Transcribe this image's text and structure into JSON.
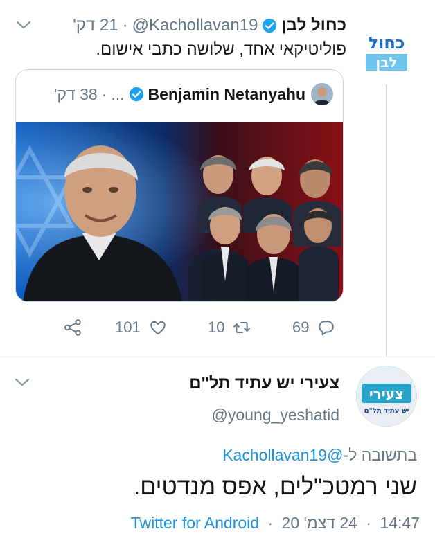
{
  "tweet1": {
    "author_name": "כחול לבן",
    "handle": "@Kachollavan19",
    "separator": "·",
    "time": "21 דק'",
    "text": "פוליטיקאי אחד, שלושה כתבי אישום.",
    "avatar_text_top": "כחול",
    "avatar_text_bottom": "לבן",
    "quoted": {
      "author_name": "Benjamin Netanyahu",
      "handle": "...",
      "separator": "·",
      "time": "38 דק'"
    },
    "actions": {
      "replies": "69",
      "retweets": "10",
      "likes": "101"
    }
  },
  "tweet2": {
    "author_name": "צעירי יש עתיד תל\"ם",
    "handle": "@young_yeshatid",
    "avatar_text_top": "צעירי",
    "avatar_text_bottom": "יש עתיד תל\"ם",
    "replying_prefix": "בתשובה ל-",
    "replying_to": "@Kachollavan19",
    "text": "שני רמטכ\"לים, אפס מנדטים.",
    "time": "14:47",
    "date": "24 דצמ' 20",
    "separator": "·",
    "source": "Twitter for Android"
  },
  "colors": {
    "link": "#1b95e0",
    "muted": "#657786",
    "text": "#14171a",
    "verified": "#1da1f2",
    "brand_blue": "#1a6fd0"
  },
  "icons": [
    "chevron-down-icon",
    "verified-badge-icon",
    "share-icon",
    "like-icon",
    "retweet-icon",
    "reply-icon"
  ]
}
